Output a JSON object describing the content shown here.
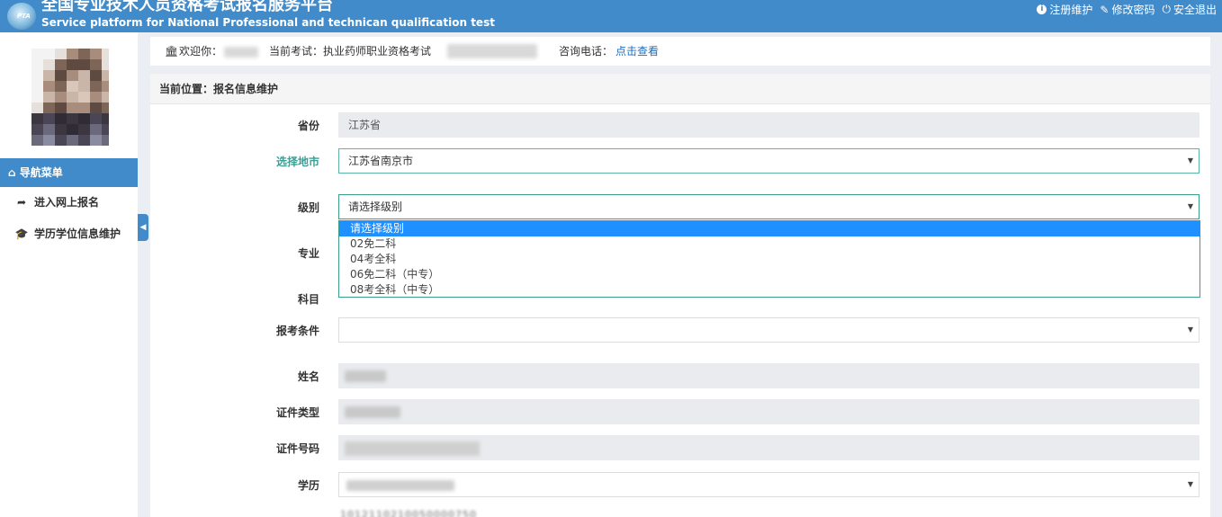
{
  "header": {
    "title_cn": "全国专业技术人员资格考试报名服务平台",
    "title_en": "Service platform for National Professional and technican qualification test",
    "logo_text": "PTA",
    "links": [
      {
        "label": "注册维护",
        "icon": "info-icon"
      },
      {
        "label": "修改密码",
        "icon": "edit-icon"
      },
      {
        "label": "安全退出",
        "icon": "power-icon"
      }
    ]
  },
  "sidebar": {
    "nav_head": "导航菜单",
    "items": [
      {
        "label": "进入网上报名",
        "icon": "share-arrow-icon"
      },
      {
        "label": "学历学位信息维护",
        "icon": "graduation-cap-icon"
      }
    ]
  },
  "info_bar": {
    "welcome": "欢迎你：",
    "current_exam": "当前考试：执业药师职业资格考试",
    "phone_label": "咨询电话：",
    "phone_link": "点击查看"
  },
  "breadcrumb": "当前位置：报名信息维护",
  "form": {
    "province": {
      "label": "省份",
      "value": "江苏省"
    },
    "city": {
      "label": "选择地市",
      "value": "江苏省南京市"
    },
    "level": {
      "label": "级别",
      "value": "请选择级别",
      "options": [
        "请选择级别",
        "02免二科",
        "04考全科",
        "06免二科（中专）",
        "08考全科（中专）"
      ],
      "selected_index": 0
    },
    "major": {
      "label": "专业"
    },
    "subject": {
      "label": "科目"
    },
    "condition": {
      "label": "报考条件",
      "value": ""
    },
    "name": {
      "label": "姓名"
    },
    "id_type": {
      "label": "证件类型"
    },
    "id_number": {
      "label": "证件号码"
    },
    "education": {
      "label": "学历"
    }
  },
  "footer_number": "1012110210050000750"
}
